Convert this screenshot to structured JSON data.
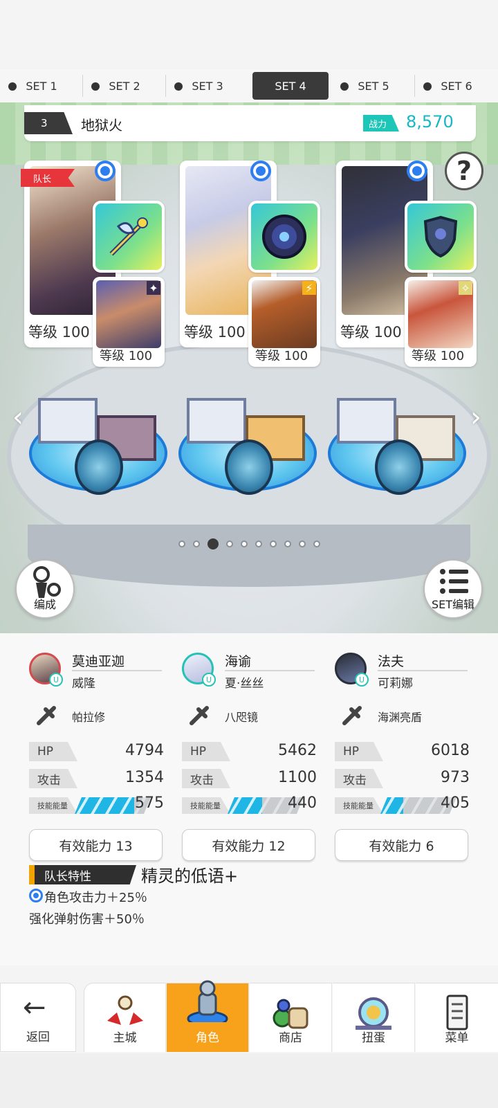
{
  "set_tabs": [
    "SET 1",
    "SET 2",
    "SET 3",
    "SET 4",
    "SET 5",
    "SET 6"
  ],
  "active_set": "SET 4",
  "team": {
    "number": "3",
    "name": "地狱火",
    "power_label": "战力",
    "power_value": "8,570"
  },
  "leader_flag": "队长",
  "help_symbol": "?",
  "heroes": [
    {
      "level": "等级 100",
      "sub_level": "等级 100",
      "equip_icon": "halberd-weapon-icon",
      "sub_badge": "dark-element-icon"
    },
    {
      "level": "等级 100",
      "sub_level": "等级 100",
      "equip_icon": "magic-mirror-icon",
      "sub_badge": "lightning-element-icon"
    },
    {
      "level": "等级 100",
      "sub_level": "等级 100",
      "equip_icon": "shell-shield-icon",
      "sub_badge": "light-element-icon"
    }
  ],
  "carousel": {
    "left_arrow": "‹",
    "right_arrow": "›",
    "pages": 10,
    "active_page": 3
  },
  "buttons": {
    "formation": "编成",
    "set_edit": "SET编辑"
  },
  "stats": [
    {
      "name": "莫迪亚迦",
      "sub": "威隆",
      "weapon": "帕拉修",
      "hp_label": "HP",
      "hp": "4794",
      "atk_label": "攻击",
      "atk": "1354",
      "energy_label": "技能能量",
      "energy": "575",
      "energy_fill": 0.78,
      "ability": "有效能力 13"
    },
    {
      "name": "海谕",
      "sub": "夏·丝丝",
      "weapon": "八咫镜",
      "hp_label": "HP",
      "hp": "5462",
      "atk_label": "攻击",
      "atk": "1100",
      "energy_label": "技能能量",
      "energy": "440",
      "energy_fill": 0.45,
      "ability": "有效能力 12"
    },
    {
      "name": "法夫",
      "sub": "可莉娜",
      "weapon": "海渊亮盾",
      "hp_label": "HP",
      "hp": "6018",
      "atk_label": "攻击",
      "atk": "973",
      "energy_label": "技能能量",
      "energy": "405",
      "energy_fill": 0.3,
      "ability": "有效能力 6"
    }
  ],
  "leader_trait": {
    "label": "队长特性",
    "name": "精灵的低语+",
    "line1": "角色攻击力＋25％",
    "line2": "强化弹射伤害＋50％"
  },
  "nav": {
    "back_symbol": "←",
    "back": "返回",
    "items": [
      "主城",
      "角色",
      "商店",
      "扭蛋",
      "菜单"
    ],
    "active": "角色"
  },
  "colors": {
    "accent": "#f7a21a",
    "power": "#17b7c8",
    "energy": "#1fb6e6",
    "leader": "#e7363b"
  }
}
